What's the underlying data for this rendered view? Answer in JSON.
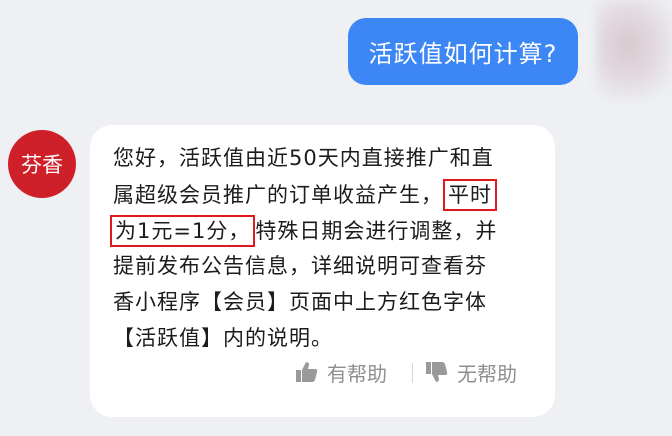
{
  "user_message": {
    "text": "活跃值如何计算?"
  },
  "bot": {
    "avatar_label": "芬香"
  },
  "bot_message": {
    "line1": "您好，活跃值由近50天内直接推广和直",
    "line2_plain": "属超级会员推广的订单收益产生，",
    "line2_highlight": "平时",
    "line3_highlight": "为1元=1分，",
    "line3_plain": "特殊日期会进行调整，并",
    "line4": "提前发布公告信息，详细说明可查看芬",
    "line5": "香小程序【会员】页面中上方红色字体",
    "line6": "【活跃值】内的说明。"
  },
  "feedback": {
    "helpful_label": "有帮助",
    "unhelpful_label": "无帮助"
  },
  "colors": {
    "user_bubble": "#3d86f6",
    "bot_avatar": "#cf2029",
    "highlight_border": "#e0191f",
    "background": "#eef0f4"
  }
}
